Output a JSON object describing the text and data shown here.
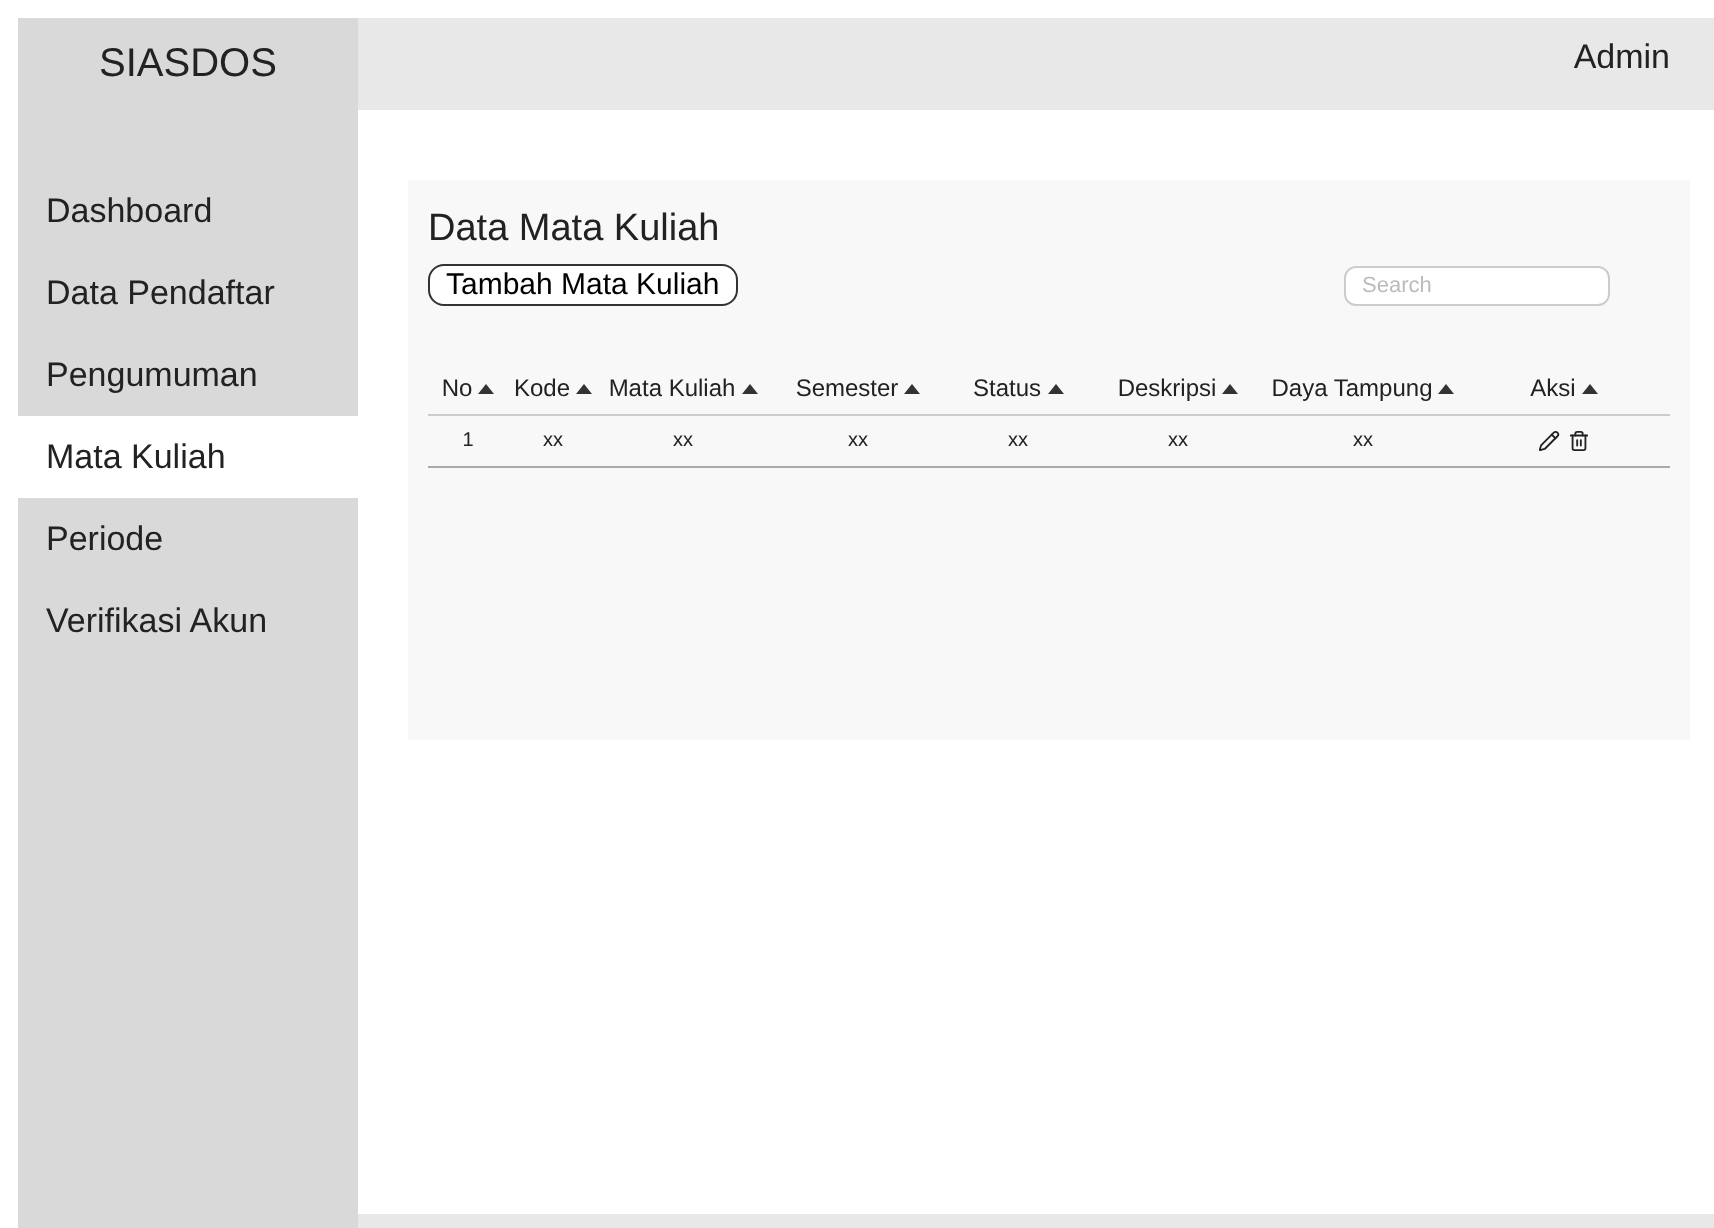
{
  "sidebar": {
    "title": "SIASDOS",
    "items": [
      {
        "label": "Dashboard",
        "selected": false
      },
      {
        "label": "Data Pendaftar",
        "selected": false
      },
      {
        "label": "Pengumuman",
        "selected": false
      },
      {
        "label": "Mata Kuliah",
        "selected": true
      },
      {
        "label": "Periode",
        "selected": false
      },
      {
        "label": "Verifikasi Akun",
        "selected": false
      }
    ]
  },
  "topbar": {
    "user": "Admin"
  },
  "card": {
    "title": "Data Mata Kuliah",
    "add_button": "Tambah Mata Kuliah",
    "search": {
      "placeholder": "Search"
    },
    "table": {
      "columns": [
        "No",
        "Kode",
        "Mata Kuliah",
        "Semester",
        "Status",
        "Deskripsi",
        "Daya Tampung",
        "Aksi"
      ],
      "rows": [
        {
          "cells": [
            "1",
            "xx",
            "xx",
            "xx",
            "xx",
            "xx",
            "xx"
          ]
        }
      ]
    }
  }
}
